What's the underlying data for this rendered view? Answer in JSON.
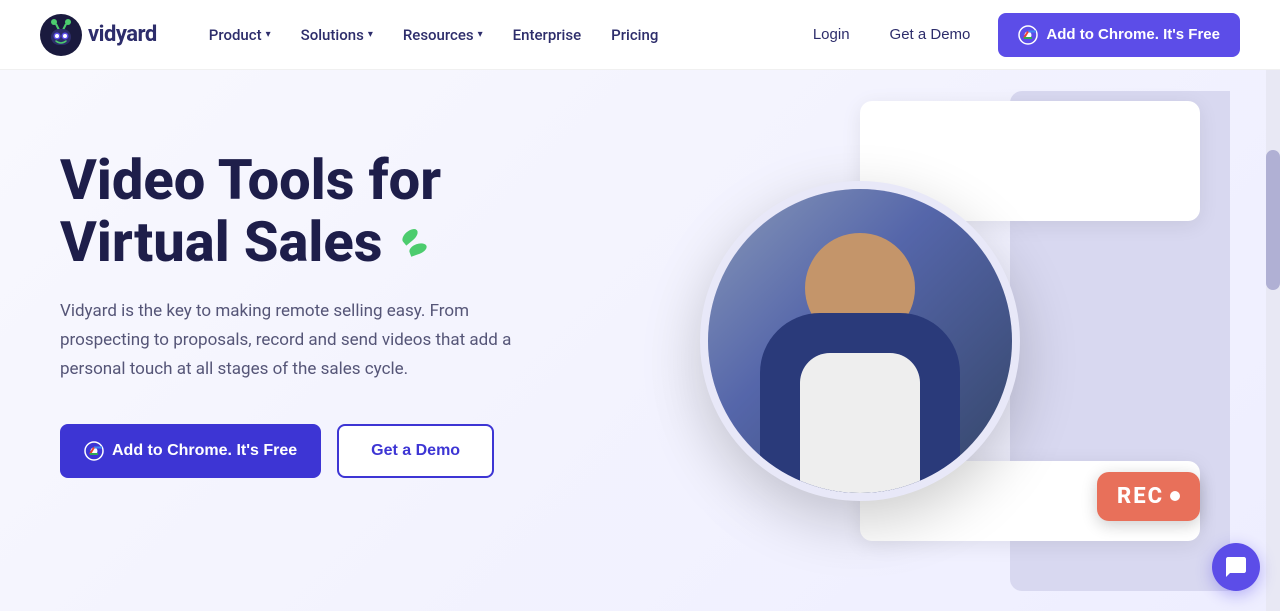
{
  "brand": {
    "name": "vidyard",
    "logo_alt": "Vidyard logo"
  },
  "navbar": {
    "product_label": "Product",
    "solutions_label": "Solutions",
    "resources_label": "Resources",
    "enterprise_label": "Enterprise",
    "pricing_label": "Pricing",
    "login_label": "Login",
    "demo_label": "Get a Demo",
    "cta_label": "Add to Chrome. It's Free"
  },
  "hero": {
    "title_line1": "Video Tools for",
    "title_line2": "Virtual Sales",
    "subtitle": "Vidyard is the key to making remote selling easy. From prospecting to proposals, record and send videos that add a personal touch at all stages of the sales cycle.",
    "cta_primary": "Add to Chrome. It's Free",
    "cta_secondary": "Get a Demo",
    "rec_label": "REC"
  },
  "chat": {
    "icon_label": "chat-icon"
  }
}
